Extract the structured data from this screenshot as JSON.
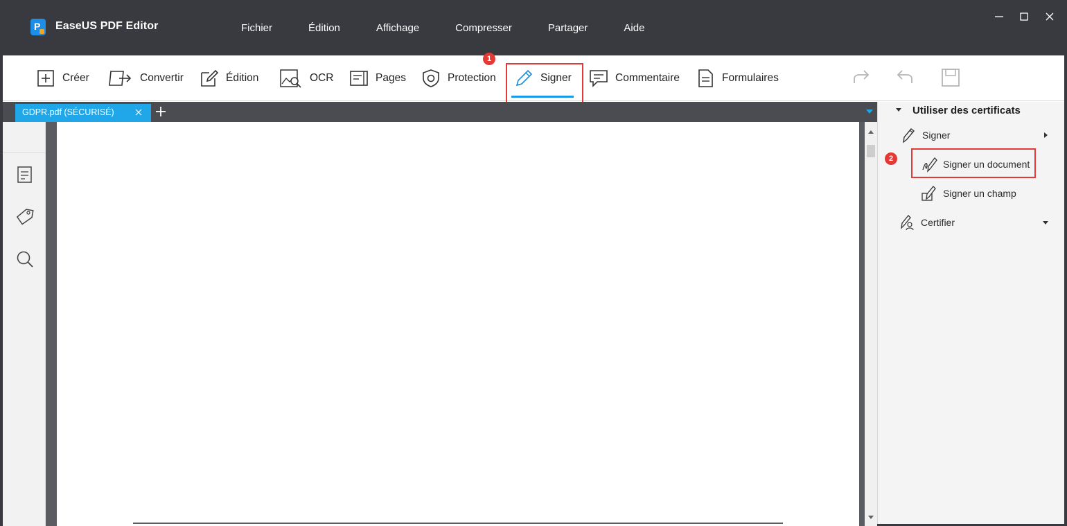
{
  "app": {
    "title": "EaseUS PDF Editor"
  },
  "menu": {
    "items": [
      "Fichier",
      "Édition",
      "Affichage",
      "Compresser",
      "Partager",
      "Aide"
    ]
  },
  "toolbar": {
    "items": [
      {
        "label": "Créer",
        "icon": "plus-square-icon"
      },
      {
        "label": "Convertir",
        "icon": "convert-icon"
      },
      {
        "label": "Édition",
        "icon": "edit-icon"
      },
      {
        "label": "OCR",
        "icon": "ocr-icon"
      },
      {
        "label": "Pages",
        "icon": "pages-icon"
      },
      {
        "label": "Protection",
        "icon": "shield-icon"
      },
      {
        "label": "Signer",
        "icon": "pen-icon",
        "active": true
      },
      {
        "label": "Commentaire",
        "icon": "comment-icon"
      },
      {
        "label": "Formulaires",
        "icon": "form-icon"
      }
    ],
    "step1": "1"
  },
  "tabs": {
    "document_tab_label": "GDPR.pdf (SÉCURISÉ)"
  },
  "right_panel": {
    "header": "Utiliser des certificats",
    "items": {
      "signer": "Signer",
      "signer_document": "Signer un document",
      "signer_champ": "Signer un champ",
      "certifier": "Certifier"
    },
    "step2": "2"
  },
  "colors": {
    "titlebar": "#383a3f",
    "accent": "#1fa7ea",
    "highlight": "#e53935"
  }
}
